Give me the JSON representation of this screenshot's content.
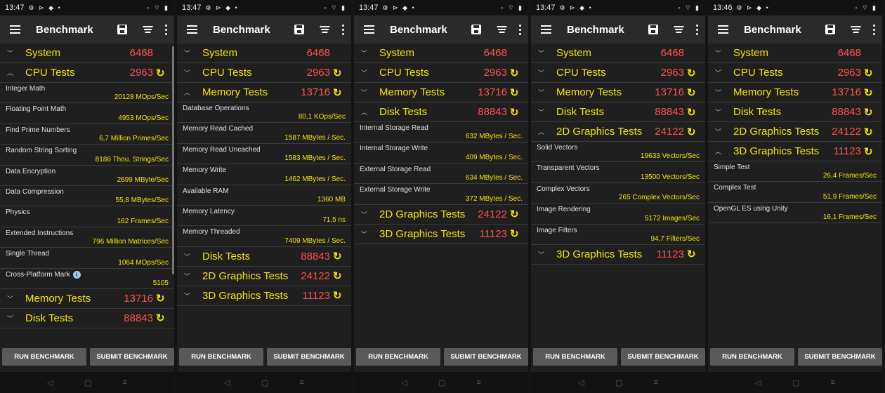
{
  "app_title": "Benchmark",
  "buttons": {
    "run": "RUN BENCHMARK",
    "submit": "SUBMIT BENCHMARK"
  },
  "status_icons": "⚙ ⊳ ◆ •",
  "status_right": "◦ ⌔ ▮",
  "icons": {
    "menu": "menu-icon",
    "save": "save-icon",
    "sort": "sort-icon",
    "more": "more-vert-icon",
    "refresh": "refresh-icon",
    "chevron_up": "chevron-up-icon",
    "chevron_down": "chevron-down-icon",
    "info": "info-icon"
  },
  "colors": {
    "category": "#f2e600",
    "score": "#ff4f4f",
    "value": "#f2e600",
    "label": "#e0e0e0",
    "background": "#1f1f1f",
    "appbar": "#2a2a2a",
    "button": "#5a5a5a"
  },
  "screens": [
    {
      "time": "13:47",
      "rows": [
        {
          "kind": "cat",
          "name": "System",
          "score": "6468",
          "chevron": "down",
          "refresh": false
        },
        {
          "kind": "cat",
          "name": "CPU Tests",
          "score": "2963",
          "chevron": "up",
          "refresh": true
        },
        {
          "kind": "item",
          "name": "Integer Math",
          "value": "20128 MOps/Sec"
        },
        {
          "kind": "item",
          "name": "Floating Point Math",
          "value": "4953 MOps/Sec"
        },
        {
          "kind": "item",
          "name": "Find Prime Numbers",
          "value": "6,7 Million Primes/Sec"
        },
        {
          "kind": "item",
          "name": "Random String Sorting",
          "value": "8186 Thou. Strings/Sec"
        },
        {
          "kind": "item",
          "name": "Data Encryption",
          "value": "2699 MByte/Sec"
        },
        {
          "kind": "item",
          "name": "Data Compression",
          "value": "55,8 MBytes/Sec"
        },
        {
          "kind": "item",
          "name": "Physics",
          "value": "162 Frames/Sec"
        },
        {
          "kind": "item",
          "name": "Extended Instructions",
          "value": "796 Million Matrices/Sec"
        },
        {
          "kind": "item",
          "name": "Single Thread",
          "value": "1064 MOps/Sec"
        },
        {
          "kind": "item",
          "name": "Cross-Platform Mark",
          "value": "5105",
          "info": true
        },
        {
          "kind": "cat",
          "name": "Memory Tests",
          "score": "13716",
          "chevron": "down",
          "refresh": true
        },
        {
          "kind": "cat",
          "name": "Disk Tests",
          "score": "88843",
          "chevron": "down",
          "refresh": true
        }
      ]
    },
    {
      "time": "13:47",
      "rows": [
        {
          "kind": "cat",
          "name": "System",
          "score": "6468",
          "chevron": "down",
          "refresh": false
        },
        {
          "kind": "cat",
          "name": "CPU Tests",
          "score": "2963",
          "chevron": "down",
          "refresh": true
        },
        {
          "kind": "cat",
          "name": "Memory Tests",
          "score": "13716",
          "chevron": "up",
          "refresh": true
        },
        {
          "kind": "item",
          "name": "Database Operations",
          "value": "80,1 KOps/Sec"
        },
        {
          "kind": "item",
          "name": "Memory Read Cached",
          "value": "1587 MBytes / Sec."
        },
        {
          "kind": "item",
          "name": "Memory Read Uncached",
          "value": "1583 MBytes / Sec."
        },
        {
          "kind": "item",
          "name": "Memory Write",
          "value": "1462 MBytes / Sec."
        },
        {
          "kind": "item",
          "name": "Available RAM",
          "value": "1360 MB"
        },
        {
          "kind": "item",
          "name": "Memory Latency",
          "value": "71,5 ns"
        },
        {
          "kind": "item",
          "name": "Memory Threaded",
          "value": "7409 MBytes / Sec."
        },
        {
          "kind": "cat",
          "name": "Disk Tests",
          "score": "88843",
          "chevron": "down",
          "refresh": true
        },
        {
          "kind": "cat",
          "name": "2D Graphics Tests",
          "score": "24122",
          "chevron": "down",
          "refresh": true
        },
        {
          "kind": "cat",
          "name": "3D Graphics Tests",
          "score": "11123",
          "chevron": "down",
          "refresh": true
        }
      ]
    },
    {
      "time": "13:47",
      "rows": [
        {
          "kind": "cat",
          "name": "System",
          "score": "6468",
          "chevron": "down",
          "refresh": false
        },
        {
          "kind": "cat",
          "name": "CPU Tests",
          "score": "2963",
          "chevron": "down",
          "refresh": true
        },
        {
          "kind": "cat",
          "name": "Memory Tests",
          "score": "13716",
          "chevron": "down",
          "refresh": true
        },
        {
          "kind": "cat",
          "name": "Disk Tests",
          "score": "88843",
          "chevron": "up",
          "refresh": true
        },
        {
          "kind": "item",
          "name": "Internal Storage Read",
          "value": "632 MBytes / Sec."
        },
        {
          "kind": "item",
          "name": "Internal Storage Write",
          "value": "409 MBytes / Sec."
        },
        {
          "kind": "item",
          "name": "External Storage Read",
          "value": "634 MBytes / Sec."
        },
        {
          "kind": "item",
          "name": "External Storage Write",
          "value": "372 MBytes / Sec."
        },
        {
          "kind": "cat",
          "name": "2D Graphics Tests",
          "score": "24122",
          "chevron": "down",
          "refresh": true
        },
        {
          "kind": "cat",
          "name": "3D Graphics Tests",
          "score": "11123",
          "chevron": "down",
          "refresh": true
        }
      ]
    },
    {
      "time": "13:47",
      "rows": [
        {
          "kind": "cat",
          "name": "System",
          "score": "6468",
          "chevron": "down",
          "refresh": false
        },
        {
          "kind": "cat",
          "name": "CPU Tests",
          "score": "2963",
          "chevron": "down",
          "refresh": true
        },
        {
          "kind": "cat",
          "name": "Memory Tests",
          "score": "13716",
          "chevron": "down",
          "refresh": true
        },
        {
          "kind": "cat",
          "name": "Disk Tests",
          "score": "88843",
          "chevron": "down",
          "refresh": true
        },
        {
          "kind": "cat",
          "name": "2D Graphics Tests",
          "score": "24122",
          "chevron": "up",
          "refresh": true
        },
        {
          "kind": "item",
          "name": "Solid Vectors",
          "value": "19633 Vectors/Sec"
        },
        {
          "kind": "item",
          "name": "Transparent Vectors",
          "value": "13500 Vectors/Sec"
        },
        {
          "kind": "item",
          "name": "Complex Vectors",
          "value": "265 Complex Vectors/Sec"
        },
        {
          "kind": "item",
          "name": "Image Rendering",
          "value": "5172 Images/Sec"
        },
        {
          "kind": "item",
          "name": "Image Filters",
          "value": "94,7 Filters/Sec"
        },
        {
          "kind": "cat",
          "name": "3D Graphics Tests",
          "score": "11123",
          "chevron": "down",
          "refresh": true
        }
      ]
    },
    {
      "time": "13:46",
      "rows": [
        {
          "kind": "cat",
          "name": "System",
          "score": "6468",
          "chevron": "down",
          "refresh": false
        },
        {
          "kind": "cat",
          "name": "CPU Tests",
          "score": "2963",
          "chevron": "down",
          "refresh": true
        },
        {
          "kind": "cat",
          "name": "Memory Tests",
          "score": "13716",
          "chevron": "down",
          "refresh": true
        },
        {
          "kind": "cat",
          "name": "Disk Tests",
          "score": "88843",
          "chevron": "down",
          "refresh": true
        },
        {
          "kind": "cat",
          "name": "2D Graphics Tests",
          "score": "24122",
          "chevron": "down",
          "refresh": true
        },
        {
          "kind": "cat",
          "name": "3D Graphics Tests",
          "score": "11123",
          "chevron": "up",
          "refresh": true
        },
        {
          "kind": "item",
          "name": "Simple Test",
          "value": "26,4 Frames/Sec"
        },
        {
          "kind": "item",
          "name": "Complex Test",
          "value": "51,9 Frames/Sec"
        },
        {
          "kind": "item",
          "name": "OpenGL ES using Unity",
          "value": "16,1 Frames/Sec"
        }
      ]
    }
  ]
}
